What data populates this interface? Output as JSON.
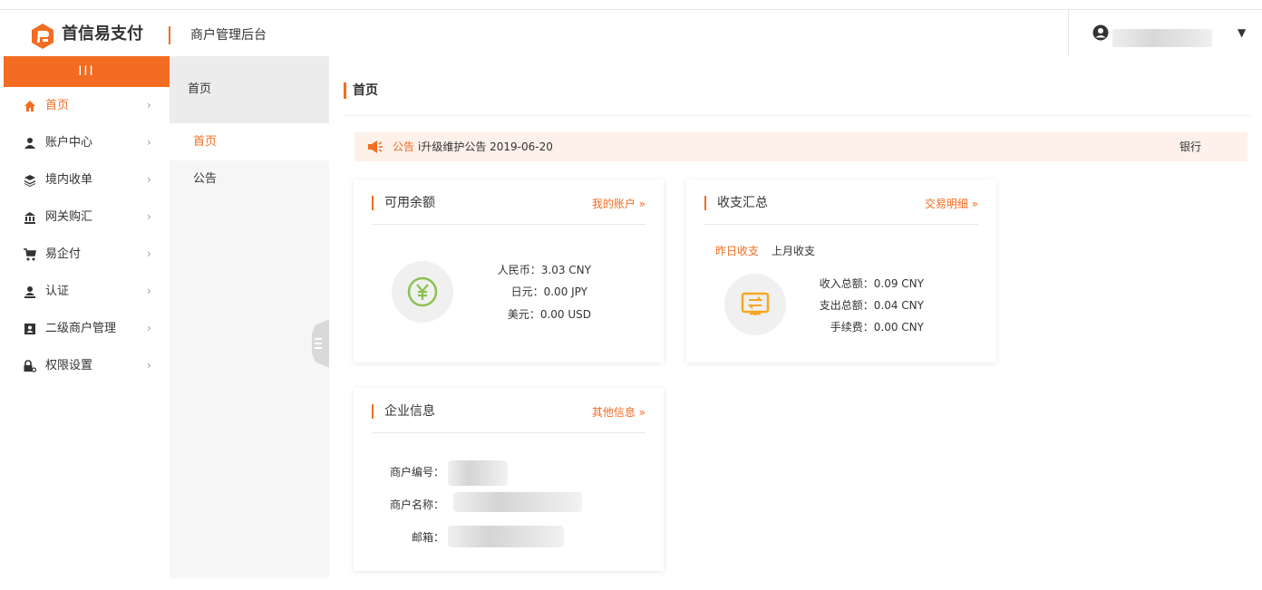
{
  "header": {
    "brand": "首信易支付",
    "subtitle": "商户管理后台",
    "user_caret": "▼"
  },
  "sidebar": {
    "collapse_label": "III",
    "items": [
      {
        "label": "首页",
        "icon": "home-icon",
        "active": true
      },
      {
        "label": "账户中心",
        "icon": "user-icon"
      },
      {
        "label": "境内收单",
        "icon": "layers-icon"
      },
      {
        "label": "网关购汇",
        "icon": "bank-icon"
      },
      {
        "label": "易企付",
        "icon": "cart-icon"
      },
      {
        "label": "认证",
        "icon": "certify-icon"
      },
      {
        "label": "二级商户管理",
        "icon": "id-card-icon"
      },
      {
        "label": "权限设置",
        "icon": "lock-icon"
      }
    ],
    "arrow": "›"
  },
  "subnav": {
    "head": "首页",
    "items": [
      {
        "label": "首页",
        "active": true
      },
      {
        "label": "公告"
      }
    ]
  },
  "main": {
    "title": "首页",
    "notice": {
      "label": "公告",
      "text": "i升级维护公告 2019-06-20",
      "bank": "银行"
    },
    "balance_card": {
      "title": "可用余额",
      "link": "我的账户 »",
      "rmb": "人民币：3.03 CNY",
      "jpy": "日元：0.00 JPY",
      "usd": "美元：0.00 USD"
    },
    "summary_card": {
      "title": "收支汇总",
      "link": "交易明细 »",
      "tab_yesterday": "昨日收支",
      "tab_last_month": "上月收支",
      "income": "收入总额：0.09 CNY",
      "expense": "支出总额：0.04 CNY",
      "fee": "手续费：0.00 CNY"
    },
    "company_card": {
      "title": "企业信息",
      "link": "其他信息 »",
      "merchant_no_label": "商户编号：",
      "merchant_name_label": "商户名称：",
      "email_label": "邮箱："
    }
  },
  "colors": {
    "accent": "#f26d21",
    "notice_bg": "#fdf1ea",
    "balance_icon": "#8cc152",
    "summary_icon": "#f5a623"
  }
}
